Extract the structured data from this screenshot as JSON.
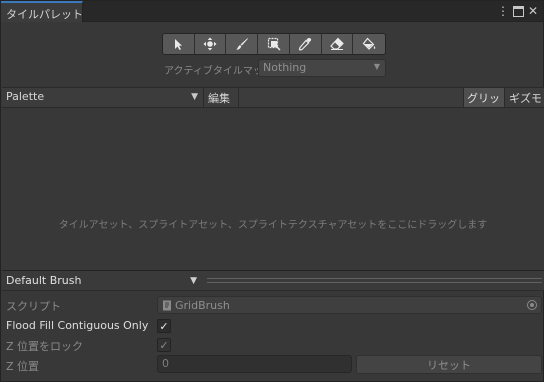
{
  "window": {
    "tab_title": "タイルパレット",
    "menu_icon": "kebab-menu-icon",
    "maximize_icon": "maximize-icon",
    "close_icon": "close-icon"
  },
  "toolbar": {
    "tools": [
      {
        "name": "select-tool",
        "icon": "arrow-cursor-icon"
      },
      {
        "name": "move-tool",
        "icon": "move-arrows-icon"
      },
      {
        "name": "paint-tool",
        "icon": "paintbrush-icon"
      },
      {
        "name": "box-fill-tool",
        "icon": "box-fill-icon"
      },
      {
        "name": "picker-tool",
        "icon": "eyedropper-icon"
      },
      {
        "name": "erase-tool",
        "icon": "eraser-icon"
      },
      {
        "name": "flood-fill-tool",
        "icon": "paint-bucket-icon"
      }
    ]
  },
  "active_tilemap": {
    "label": "アクティブタイルマップ",
    "value": "Nothing"
  },
  "palette_bar": {
    "palette_value": "Palette",
    "edit_label": "編集",
    "grid_label": "グリッド",
    "gizmo_label": "ギズモ"
  },
  "drop_area": {
    "hint": "タイルアセット、スプライトアセット、スプライトテクスチャアセットをここにドラッグします"
  },
  "brush": {
    "value": "Default Brush",
    "script_label": "スクリプト",
    "script_value": "GridBrush",
    "flood_fill_label": "Flood Fill Contiguous Only",
    "flood_fill_checked": true,
    "lock_z_label": "Z 位置をロック",
    "lock_z_checked": true,
    "z_position_label": "Z 位置",
    "z_position_value": "0",
    "reset_label": "リセット",
    "check_mark": "✓"
  },
  "colors": {
    "background": "#383838",
    "tab_accent": "#3a79bb",
    "tool_button": "#585858"
  }
}
